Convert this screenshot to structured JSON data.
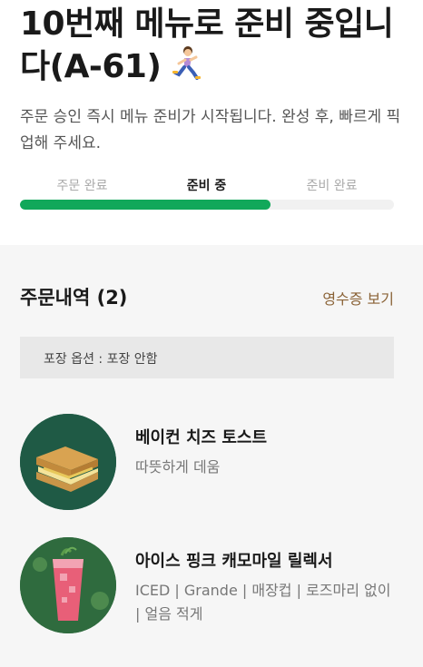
{
  "header": {
    "title": "10번째 메뉴로 준비 중입니다(A-61)",
    "subtitle": "주문 승인 즉시 메뉴 준비가 시작됩니다. 완성 후, 빠르게 픽업해 주세요.",
    "runner_icon": "running-woman-emoji"
  },
  "progress": {
    "steps": [
      "주문 완료",
      "준비 중",
      "준비 완료"
    ],
    "active_index": 1,
    "fill_fraction": 0.67,
    "fill_color": "#11a85a"
  },
  "order": {
    "title": "주문내역 (2)",
    "receipt_link": "영수증 보기",
    "packaging_option": "포장 옵션 : 포장 안함"
  },
  "items": [
    {
      "name": "베이컨 치즈 토스트",
      "description": "따뜻하게 데움",
      "image_icon": "toast-sandwich-image"
    },
    {
      "name": "아이스 핑크 캐모마일 릴렉서",
      "description": "ICED | Grande | 매장컵 | 로즈마리 없이 | 얼음 적게",
      "image_icon": "pink-iced-drink-image"
    }
  ],
  "colors": {
    "accent_green": "#11a85a",
    "link_brown": "#8a6236",
    "thumb_bg": "#1f5a45"
  }
}
